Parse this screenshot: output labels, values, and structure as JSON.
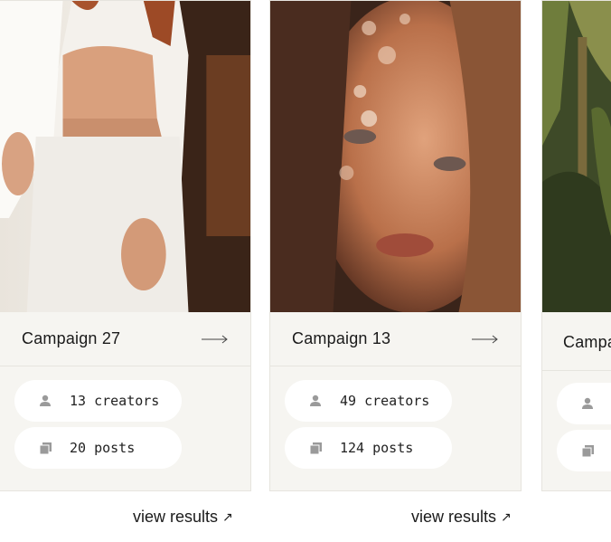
{
  "campaigns": [
    {
      "title": "Campaign 27",
      "creators": "13 creators",
      "posts": "20 posts",
      "link": "view results",
      "photo": "woman-in-white-suit-photo"
    },
    {
      "title": "Campaign 13",
      "creators": "49 creators",
      "posts": "124 posts",
      "link": "view results",
      "photo": "woman-face-bokeh-photo"
    },
    {
      "title": "Campa",
      "photo": "jungle-plants-photo"
    }
  ],
  "icons": {
    "arrow": "long-arrow-right-icon",
    "creators": "person-icon",
    "posts": "stacked-images-icon",
    "external": "arrow-up-right-icon"
  },
  "colors": {
    "card_bg": "#f6f5f1",
    "pill_bg": "#ffffff",
    "icon": "#9a9a9a"
  }
}
